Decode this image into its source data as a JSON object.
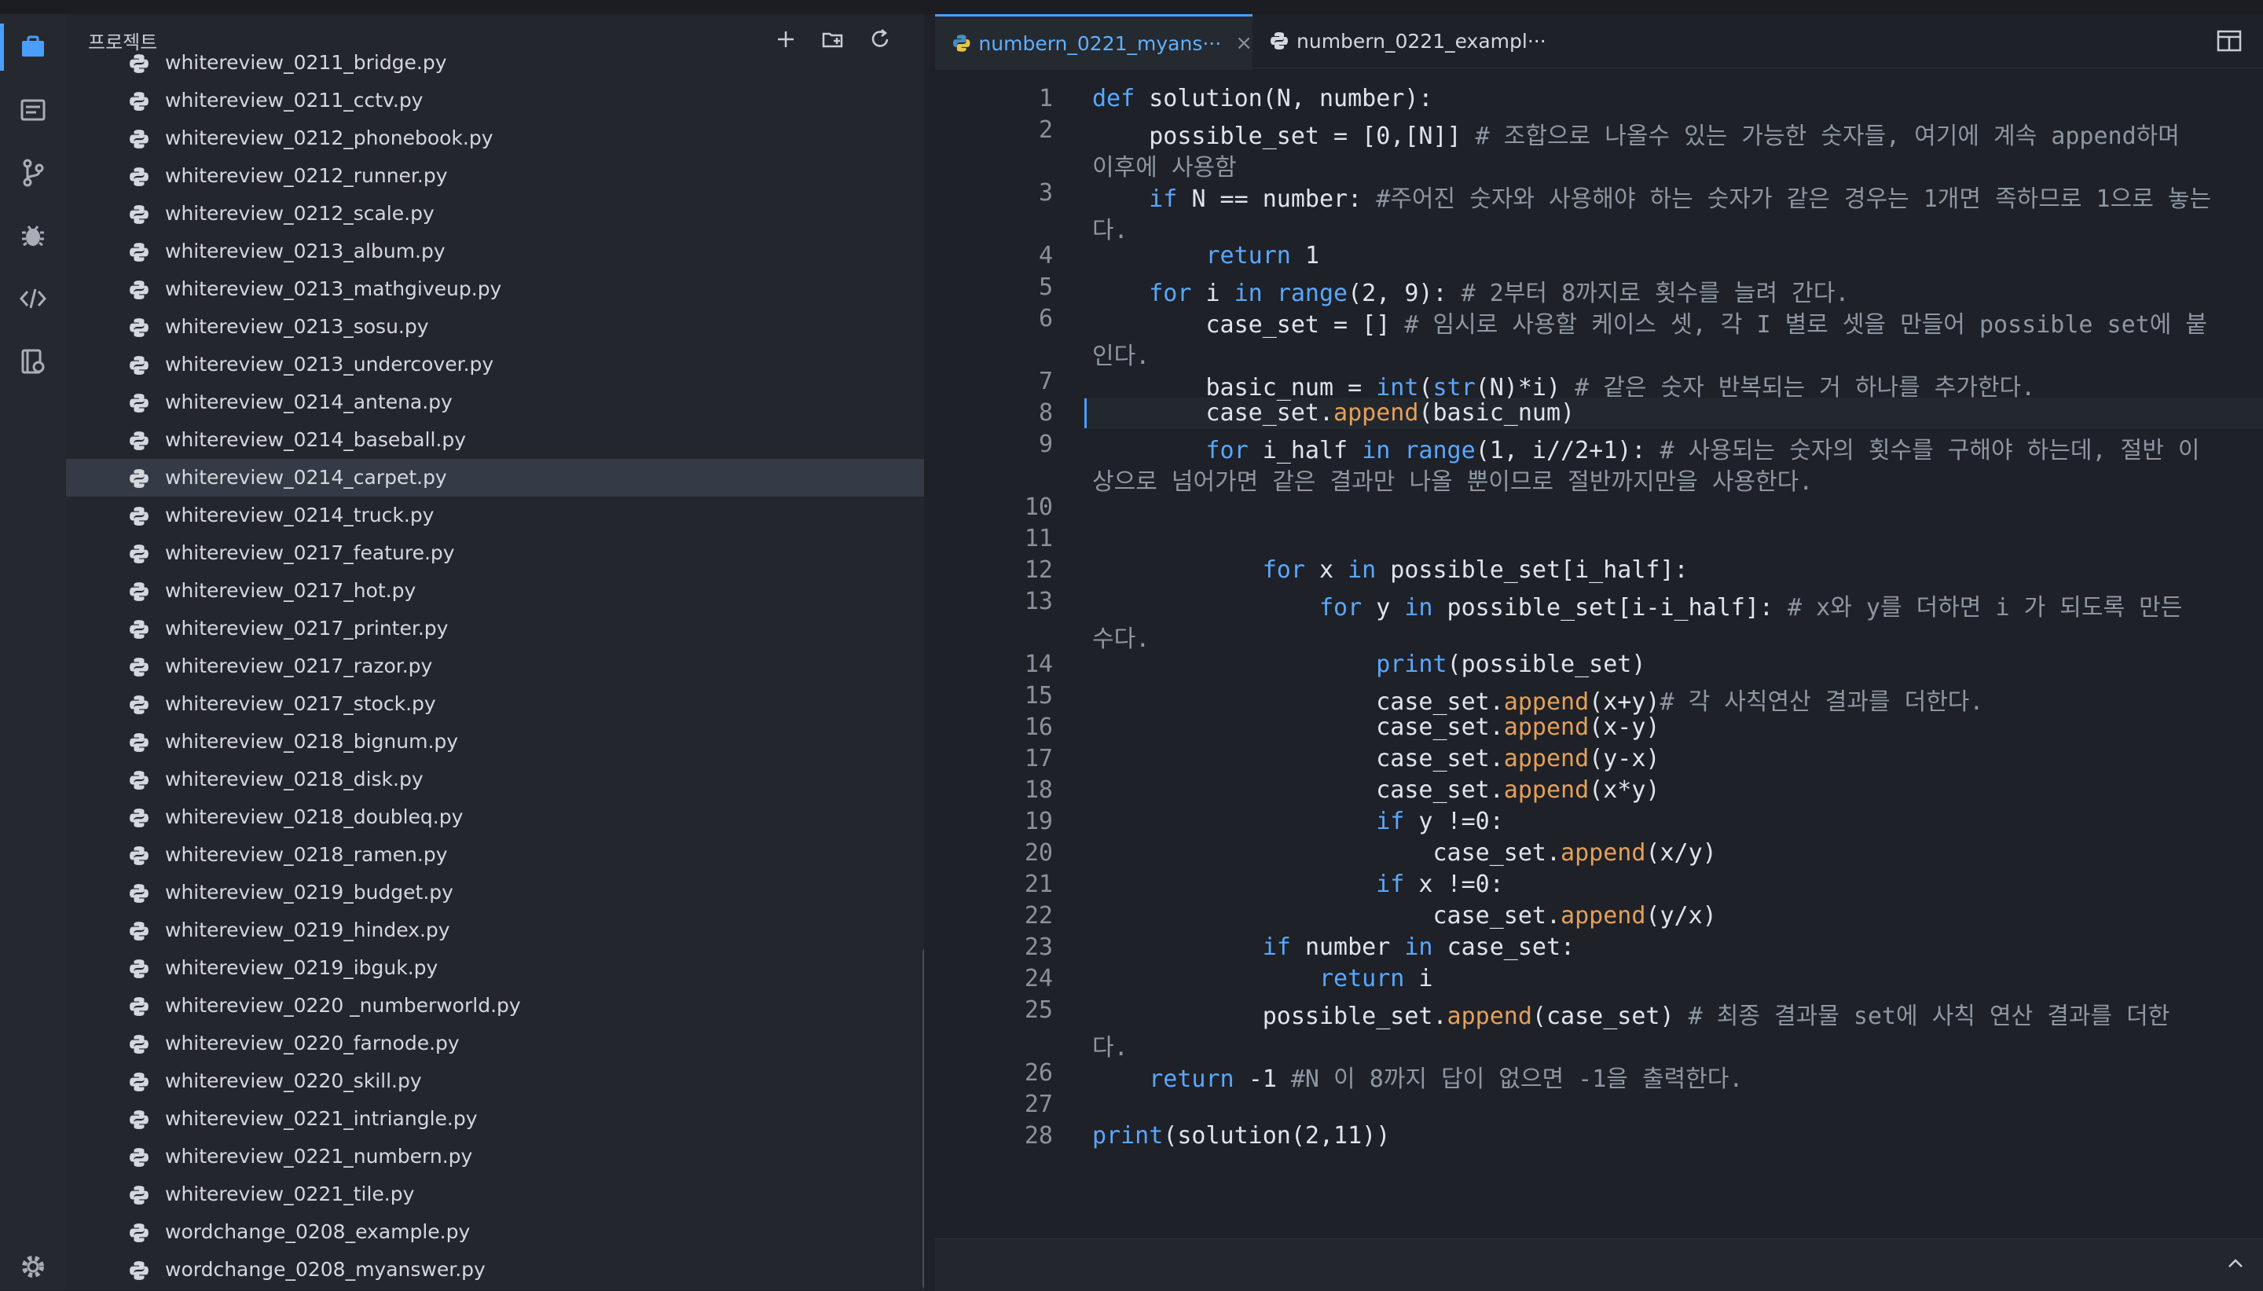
{
  "colors": {
    "accent": "#4a9eff",
    "keyword": "#5aa7ff",
    "function": "#e5a05a",
    "comment": "#8e96a3",
    "python_blue": "#4b8bbe",
    "python_yellow": "#e8c547"
  },
  "activity_bar": {
    "icons": [
      "projects-icon",
      "document-icon",
      "git-branch-icon",
      "debug-bug-icon",
      "code-icon",
      "snippets-icon",
      "settings-icon"
    ]
  },
  "sidebar": {
    "title": "프로젝트",
    "actions": [
      "new-file-icon",
      "new-folder-icon",
      "refresh-icon"
    ],
    "files": [
      {
        "name": "whitereview_0211_bridge.py"
      },
      {
        "name": "whitereview_0211_cctv.py"
      },
      {
        "name": "whitereview_0212_phonebook.py"
      },
      {
        "name": "whitereview_0212_runner.py"
      },
      {
        "name": "whitereview_0212_scale.py"
      },
      {
        "name": "whitereview_0213_album.py"
      },
      {
        "name": "whitereview_0213_mathgiveup.py"
      },
      {
        "name": "whitereview_0213_sosu.py"
      },
      {
        "name": "whitereview_0213_undercover.py"
      },
      {
        "name": "whitereview_0214_antena.py"
      },
      {
        "name": "whitereview_0214_baseball.py"
      },
      {
        "name": "whitereview_0214_carpet.py",
        "selected": true
      },
      {
        "name": "whitereview_0214_truck.py"
      },
      {
        "name": "whitereview_0217_feature.py"
      },
      {
        "name": "whitereview_0217_hot.py"
      },
      {
        "name": "whitereview_0217_printer.py"
      },
      {
        "name": "whitereview_0217_razor.py"
      },
      {
        "name": "whitereview_0217_stock.py"
      },
      {
        "name": "whitereview_0218_bignum.py"
      },
      {
        "name": "whitereview_0218_disk.py"
      },
      {
        "name": "whitereview_0218_doubleq.py"
      },
      {
        "name": "whitereview_0218_ramen.py"
      },
      {
        "name": "whitereview_0219_budget.py"
      },
      {
        "name": "whitereview_0219_hindex.py"
      },
      {
        "name": "whitereview_0219_ibguk.py"
      },
      {
        "name": "whitereview_0220 _numberworld.py"
      },
      {
        "name": "whitereview_0220_farnode.py"
      },
      {
        "name": "whitereview_0220_skill.py"
      },
      {
        "name": "whitereview_0221_intriangle.py"
      },
      {
        "name": "whitereview_0221_numbern.py"
      },
      {
        "name": "whitereview_0221_tile.py"
      },
      {
        "name": "wordchange_0208_example.py"
      },
      {
        "name": "wordchange_0208_myanswer.py"
      }
    ]
  },
  "editor": {
    "tabs": [
      {
        "label": "numbern_0221_myans···",
        "active": true,
        "close": "×"
      },
      {
        "label": "numbern_0221_exampl···",
        "active": false
      }
    ],
    "current_line": 8,
    "lines": [
      {
        "n": "1",
        "segs": [
          [
            "kw",
            "def "
          ],
          [
            "",
            "solution(N, number):"
          ]
        ]
      },
      {
        "n": "2",
        "segs": [
          [
            "",
            "    possible_set = [0,[N]] "
          ],
          [
            "cm",
            "# 조합으로 나올수 있는 가능한 숫자들, 여기에 계속 append하며"
          ]
        ],
        "wrap": [
          [
            "cm",
            "이후에 사용함"
          ]
        ]
      },
      {
        "n": "3",
        "segs": [
          [
            "kw",
            "    if "
          ],
          [
            "",
            "N == number: "
          ],
          [
            "cm",
            "#주어진 숫자와 사용해야 하는 숫자가 같은 경우는 1개면 족하므로 1으로 놓는"
          ]
        ],
        "wrap": [
          [
            "cm",
            "다."
          ]
        ]
      },
      {
        "n": "4",
        "segs": [
          [
            "kw",
            "        return "
          ],
          [
            "",
            "1"
          ]
        ]
      },
      {
        "n": "5",
        "segs": [
          [
            "kw",
            "    for "
          ],
          [
            "",
            "i "
          ],
          [
            "kw",
            "in "
          ],
          [
            "kw",
            "range"
          ],
          [
            "",
            "(2, 9): "
          ],
          [
            "cm",
            "# 2부터 8까지로 횟수를 늘려 간다."
          ]
        ]
      },
      {
        "n": "6",
        "segs": [
          [
            "",
            "        case_set = [] "
          ],
          [
            "cm",
            "# 임시로 사용할 케이스 셋, 각 I 별로 셋을 만들어 possible set에 붙"
          ]
        ],
        "wrap": [
          [
            "cm",
            "인다."
          ]
        ]
      },
      {
        "n": "7",
        "segs": [
          [
            "",
            "        basic_num = "
          ],
          [
            "kw",
            "int"
          ],
          [
            "",
            "("
          ],
          [
            "kw",
            "str"
          ],
          [
            "",
            "(N)*i) "
          ],
          [
            "cm",
            "# 같은 숫자 반복되는 거 하나를 추가한다."
          ]
        ]
      },
      {
        "n": "8",
        "segs": [
          [
            "",
            "        case_set."
          ],
          [
            "fn",
            "append"
          ],
          [
            "",
            "(basic_num)"
          ]
        ]
      },
      {
        "n": "9",
        "segs": [
          [
            "kw",
            "        for "
          ],
          [
            "",
            "i_half "
          ],
          [
            "kw",
            "in "
          ],
          [
            "kw",
            "range"
          ],
          [
            "",
            "(1, i//2+1): "
          ],
          [
            "cm",
            "# 사용되는 숫자의 횟수를 구해야 하는데, 절반 이"
          ]
        ],
        "wrap": [
          [
            "cm",
            "상으로 넘어가면 같은 결과만 나올 뿐이므로 절반까지만을 사용한다."
          ]
        ]
      },
      {
        "n": "10",
        "segs": []
      },
      {
        "n": "11",
        "segs": []
      },
      {
        "n": "12",
        "segs": [
          [
            "kw",
            "            for "
          ],
          [
            "",
            "x "
          ],
          [
            "kw",
            "in "
          ],
          [
            "",
            "possible_set[i_half]:"
          ]
        ]
      },
      {
        "n": "13",
        "segs": [
          [
            "kw",
            "                for "
          ],
          [
            "",
            "y "
          ],
          [
            "kw",
            "in "
          ],
          [
            "",
            "possible_set[i-i_half]: "
          ],
          [
            "cm",
            "# x와 y를 더하면 i 가 되도록 만든"
          ]
        ],
        "wrap": [
          [
            "cm",
            "수다."
          ]
        ]
      },
      {
        "n": "14",
        "segs": [
          [
            "kw",
            "                    print"
          ],
          [
            "",
            "(possible_set)"
          ]
        ]
      },
      {
        "n": "15",
        "segs": [
          [
            "",
            "                    case_set."
          ],
          [
            "fn",
            "append"
          ],
          [
            "",
            "(x+y)"
          ],
          [
            "cm",
            "# 각 사칙연산 결과를 더한다."
          ]
        ]
      },
      {
        "n": "16",
        "segs": [
          [
            "",
            "                    case_set."
          ],
          [
            "fn",
            "append"
          ],
          [
            "",
            "(x-y)"
          ]
        ]
      },
      {
        "n": "17",
        "segs": [
          [
            "",
            "                    case_set."
          ],
          [
            "fn",
            "append"
          ],
          [
            "",
            "(y-x)"
          ]
        ]
      },
      {
        "n": "18",
        "segs": [
          [
            "",
            "                    case_set."
          ],
          [
            "fn",
            "append"
          ],
          [
            "",
            "(x*y)"
          ]
        ]
      },
      {
        "n": "19",
        "segs": [
          [
            "kw",
            "                    if "
          ],
          [
            "",
            "y !=0:"
          ]
        ]
      },
      {
        "n": "20",
        "segs": [
          [
            "",
            "                        case_set."
          ],
          [
            "fn",
            "append"
          ],
          [
            "",
            "(x/y)"
          ]
        ]
      },
      {
        "n": "21",
        "segs": [
          [
            "kw",
            "                    if "
          ],
          [
            "",
            "x !=0:"
          ]
        ]
      },
      {
        "n": "22",
        "segs": [
          [
            "",
            "                        case_set."
          ],
          [
            "fn",
            "append"
          ],
          [
            "",
            "(y/x)"
          ]
        ]
      },
      {
        "n": "23",
        "segs": [
          [
            "kw",
            "            if "
          ],
          [
            "",
            "number "
          ],
          [
            "kw",
            "in "
          ],
          [
            "",
            "case_set:"
          ]
        ]
      },
      {
        "n": "24",
        "segs": [
          [
            "kw",
            "                return "
          ],
          [
            "",
            "i"
          ]
        ]
      },
      {
        "n": "25",
        "segs": [
          [
            "",
            "            possible_set."
          ],
          [
            "fn",
            "append"
          ],
          [
            "",
            "(case_set) "
          ],
          [
            "cm",
            "# 최종 결과물 set에 사칙 연산 결과를 더한"
          ]
        ],
        "wrap": [
          [
            "cm",
            "다."
          ]
        ]
      },
      {
        "n": "26",
        "segs": [
          [
            "kw",
            "    return "
          ],
          [
            "",
            "-1 "
          ],
          [
            "cm",
            "#N 이 8까지 답이 없으면 -1을 출력한다."
          ]
        ]
      },
      {
        "n": "27",
        "segs": []
      },
      {
        "n": "28",
        "segs": [
          [
            "kw",
            "print"
          ],
          [
            "",
            "(solution(2,11))"
          ]
        ]
      }
    ]
  }
}
